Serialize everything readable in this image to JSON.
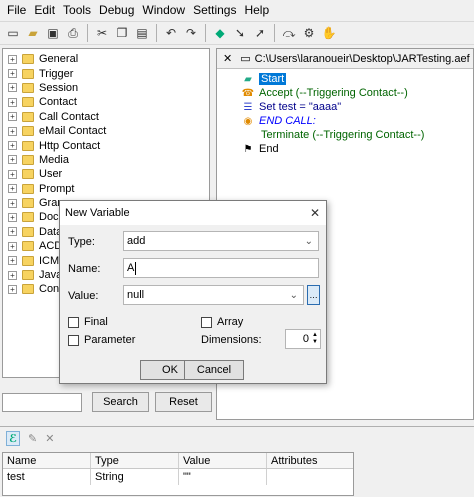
{
  "menu": [
    "File",
    "Edit",
    "Tools",
    "Debug",
    "Window",
    "Settings",
    "Help"
  ],
  "tree": {
    "items": [
      "General",
      "Trigger",
      "Session",
      "Contact",
      "Call Contact",
      "eMail Contact",
      "Http Contact",
      "Media",
      "User",
      "Prompt",
      "Grammar",
      "Document",
      "Database",
      "ACD",
      "ICM",
      "Java",
      "Context"
    ]
  },
  "search": {
    "input_value": "",
    "search_label": "Search",
    "reset_label": "Reset"
  },
  "script": {
    "tab_title": "C:\\Users\\laranoueir\\Desktop\\JARTesting.aef",
    "close_glyph": "✕",
    "nodes": [
      {
        "label": "Start",
        "selected": true
      },
      {
        "label": "Accept (--Triggering Contact--)"
      },
      {
        "label": "Set test = \"aaaa\""
      },
      {
        "label": "END CALL:"
      },
      {
        "label": "Terminate (--Triggering Contact--)"
      },
      {
        "label": "End"
      }
    ]
  },
  "variables": {
    "headers": [
      "Name",
      "Type",
      "Value",
      "Attributes"
    ],
    "rows": [
      {
        "name": "test",
        "type": "String",
        "value": "\"\"",
        "attributes": ""
      }
    ]
  },
  "dialog": {
    "title": "New Variable",
    "close_glyph": "✕",
    "type_label": "Type:",
    "type_value": "add",
    "name_label": "Name:",
    "name_value": "A",
    "value_label": "Value:",
    "value_value": "null",
    "final_label": "Final",
    "array_label": "Array",
    "parameter_label": "Parameter",
    "dimensions_label": "Dimensions:",
    "dimensions_value": "0",
    "ok_label": "OK",
    "cancel_label": "Cancel"
  },
  "colors": {
    "accent": "#0078d7",
    "keyword_blue": "#0000ff",
    "label_green": "#006400"
  }
}
